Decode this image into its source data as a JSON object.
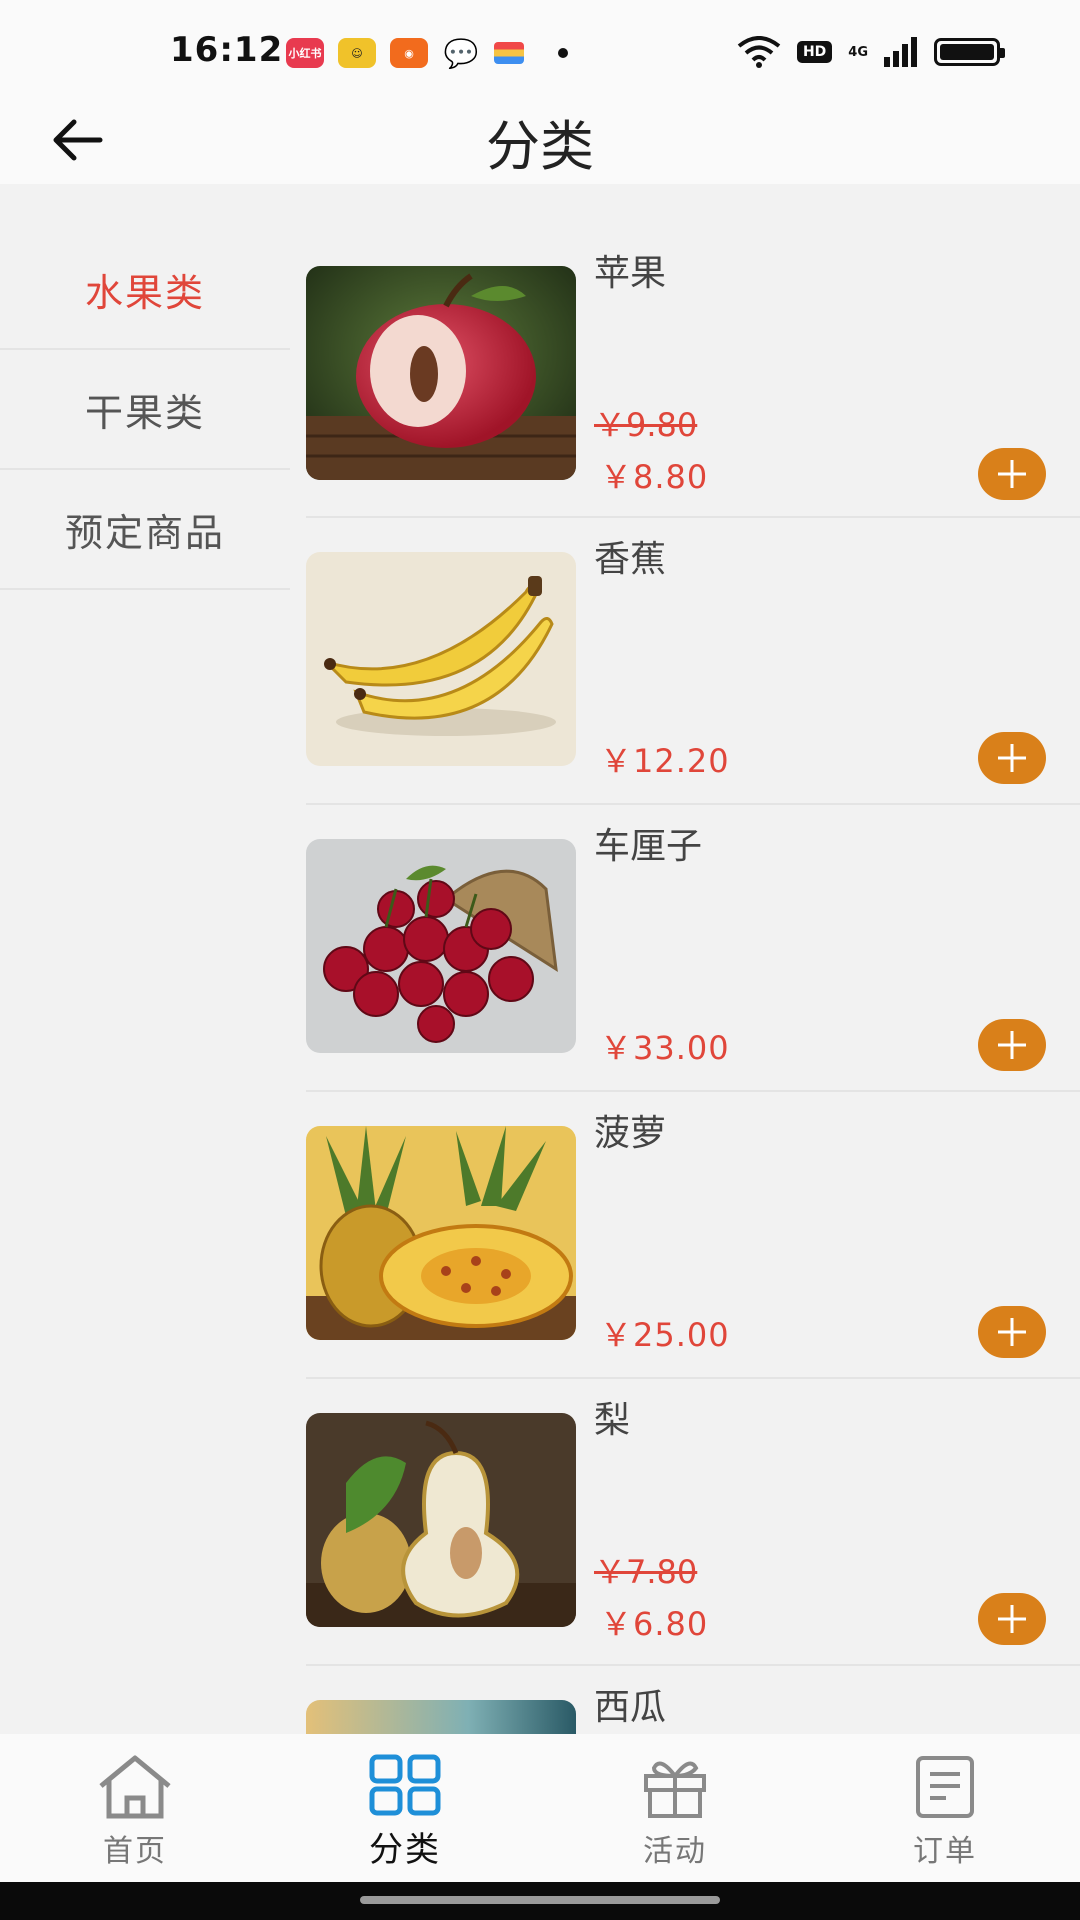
{
  "status": {
    "time": "16:12",
    "notif_red": "小红书",
    "hd": "HD",
    "signal": "4G"
  },
  "nav": {
    "title": "分类"
  },
  "categories": [
    {
      "label": "水果类",
      "active": true
    },
    {
      "label": "干果类",
      "active": false
    },
    {
      "label": "预定商品",
      "active": false
    }
  ],
  "products": [
    {
      "name": "苹果",
      "old_price": "￥9.80",
      "price": "￥8.80",
      "image": "apple"
    },
    {
      "name": "香蕉",
      "old_price": "",
      "price": "￥12.20",
      "image": "banana"
    },
    {
      "name": "车厘子",
      "old_price": "",
      "price": "￥33.00",
      "image": "cherry"
    },
    {
      "name": "菠萝",
      "old_price": "",
      "price": "￥25.00",
      "image": "pineapple"
    },
    {
      "name": "梨",
      "old_price": "￥7.80",
      "price": "￥6.80",
      "image": "pear"
    },
    {
      "name": "西瓜",
      "old_price": "",
      "price": "",
      "image": "watermelon"
    }
  ],
  "tabs": [
    {
      "label": "首页",
      "icon": "home-icon"
    },
    {
      "label": "分类",
      "icon": "grid-icon"
    },
    {
      "label": "活动",
      "icon": "gift-icon"
    },
    {
      "label": "订单",
      "icon": "order-icon"
    }
  ],
  "colors": {
    "accent_red": "#e0463a",
    "add_button": "#d9801a",
    "active_tab_icon": "#1e8fd8"
  }
}
